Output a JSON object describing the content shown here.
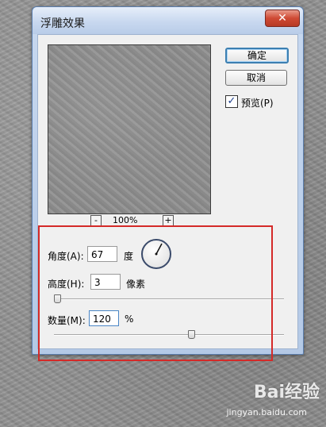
{
  "dialog": {
    "title": "浮雕效果",
    "close_icon": "close-icon",
    "close_glyph": "✕"
  },
  "buttons": {
    "ok": "确定",
    "cancel": "取消"
  },
  "preview": {
    "checkbox_label": "预览(P)",
    "checked": true,
    "check_glyph": "✓"
  },
  "zoom": {
    "minus": "-",
    "plus": "+",
    "level": "100%"
  },
  "params": {
    "angle": {
      "label": "角度(A):",
      "value": "67",
      "unit": "度"
    },
    "height": {
      "label": "高度(H):",
      "value": "3",
      "unit": "像素"
    },
    "amount": {
      "label": "数量(M):",
      "value": "120",
      "unit": "%"
    }
  },
  "colors": {
    "annotation": "#d42a28",
    "accent": "#3c7fb1"
  },
  "watermark": {
    "brand": "Bai经验",
    "url": "jingyan.baidu.com"
  }
}
